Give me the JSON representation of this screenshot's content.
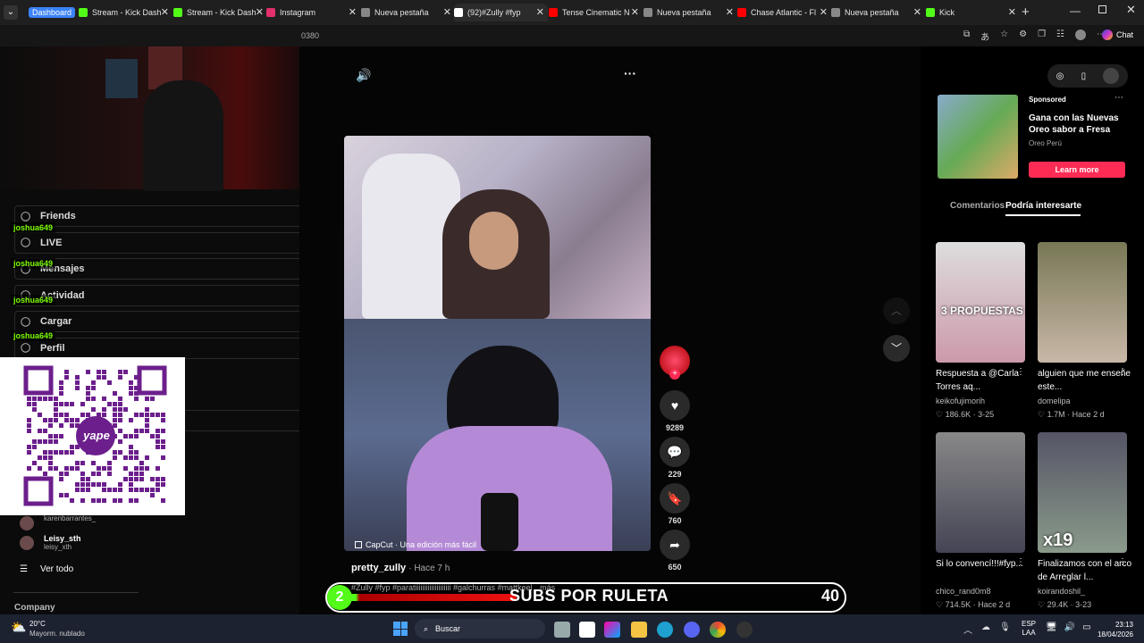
{
  "tabs": [
    {
      "label": "Dashboard",
      "badge": true,
      "color": "#3b82f6"
    },
    {
      "label": "Stream - Kick Dash",
      "color": "#53fc18"
    },
    {
      "label": "Stream - Kick Dash",
      "color": "#53fc18"
    },
    {
      "label": "Instagram",
      "color": "#e1306c"
    },
    {
      "label": "Nueva pestaña",
      "color": "#888888"
    },
    {
      "label": "(92)#Zully #fyp",
      "color": "#ffffff",
      "active": true
    },
    {
      "label": "Tense Cinematic N",
      "color": "#ff0000"
    },
    {
      "label": "Nueva pestaña",
      "color": "#888888"
    },
    {
      "label": "Chase Atlantic - Fl",
      "color": "#ff0000"
    },
    {
      "label": "Nueva pestaña",
      "color": "#888888"
    },
    {
      "label": "Kick",
      "color": "#53fc18"
    }
  ],
  "address": {
    "partial_url": "0380",
    "chat_label": "Chat"
  },
  "left_menu": [
    {
      "label": "Friends",
      "icon": "friends-icon"
    },
    {
      "label": "LIVE",
      "icon": "live-icon"
    },
    {
      "label": "Mensajes",
      "icon": "messages-icon"
    },
    {
      "label": "Actividad",
      "icon": "activity-icon"
    },
    {
      "label": "Cargar",
      "icon": "upload-icon"
    },
    {
      "label": "Perfil",
      "icon": "profile-icon"
    }
  ],
  "chat_names": [
    "joshua649",
    "joshua649",
    "joshua649",
    "joshua649"
  ],
  "following": [
    {
      "name": "",
      "handle": "karenbarrantes_"
    },
    {
      "name": "Leisy_sth",
      "handle": "leisy_xth"
    }
  ],
  "see_all": "Ver todo",
  "company": "Company",
  "qr_brand": "yape",
  "video": {
    "author": "pretty_zully",
    "time": "Hace 7 h",
    "caption": "#Zully #fyp #paratiiiiiiiiiiiiiiiiiiii #galchurras #mattkeel",
    "more": "más",
    "capcut": "CapCut · Una edición más fácil",
    "likes": "9289",
    "comments": "229",
    "saves": "760",
    "shares": "650"
  },
  "overlay": {
    "left_number": "2",
    "text": "SUBS POR RULETA",
    "right_number": "40"
  },
  "sponsored": {
    "label": "Sponsored",
    "title": "Gana con las Nuevas Oreo sabor a Fresa",
    "brand": "Oreo Perú",
    "cta": "Learn more"
  },
  "right_tabs": [
    "Comentarios",
    "Podría interesarte"
  ],
  "recommendations": [
    {
      "title": "Respuesta a @Carla Torres aq...",
      "user": "keikofujimorih",
      "likes": "186.6K",
      "date": "3-25",
      "overlay": "3 PROPUESTAS"
    },
    {
      "title": "alguien que me enseñe este...",
      "user": "domelipa",
      "likes": "1.7M",
      "date": "Hace 2 d",
      "overlay": ""
    },
    {
      "title": "Si lo convencí!!!#fyp...",
      "user": "chico_rand0m8",
      "likes": "714.5K",
      "date": "Hace 2 d",
      "overlay": ""
    },
    {
      "title": "Finalizamos con el arco de Arreglar l...",
      "user": "koirandoshil_",
      "likes": "29.4K",
      "date": "3-23",
      "overlay": "x19"
    }
  ],
  "taskbar": {
    "weather_temp": "20°C",
    "weather_desc": "Mayorm. nublado",
    "search": "Buscar",
    "lang1": "ESP",
    "lang2": "LAA",
    "time": "23:13",
    "date": "18/04/2026"
  },
  "colors": {
    "tiktok_red": "#fe2c55",
    "kick_green": "#53fc18",
    "yape_purple": "#6c1f8c"
  }
}
